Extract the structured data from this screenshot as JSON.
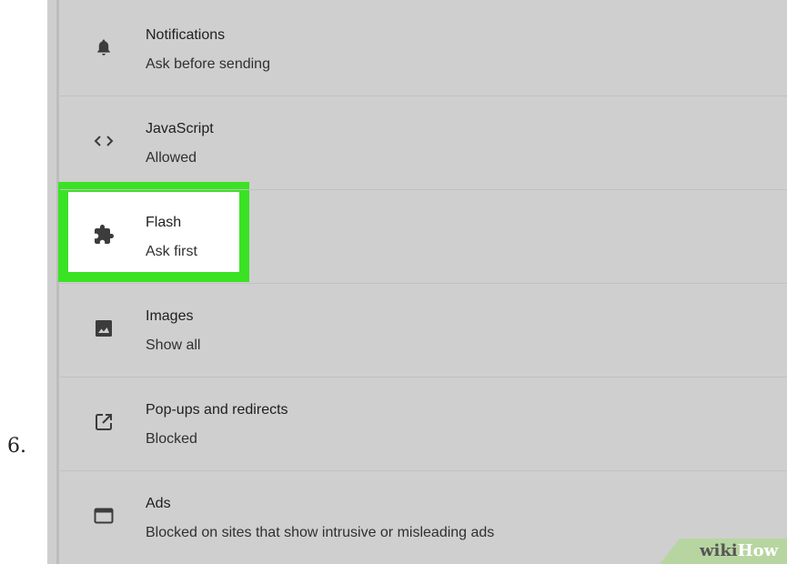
{
  "step": "6.",
  "settings": [
    {
      "title": "Notifications",
      "subtitle": "Ask before sending",
      "icon": "bell-icon"
    },
    {
      "title": "JavaScript",
      "subtitle": "Allowed",
      "icon": "code-brackets-icon"
    },
    {
      "title": "Flash",
      "subtitle": "Ask first",
      "icon": "puzzle-piece-icon"
    },
    {
      "title": "Images",
      "subtitle": "Show all",
      "icon": "image-icon"
    },
    {
      "title": "Pop-ups and redirects",
      "subtitle": "Blocked",
      "icon": "open-in-new-icon"
    },
    {
      "title": "Ads",
      "subtitle": "Blocked on sites that show intrusive or misleading ads",
      "icon": "browser-window-icon"
    }
  ],
  "highlight": {
    "target": "Flash",
    "color": "#3ae224"
  },
  "watermark": {
    "part1": "wiki",
    "part2": "How"
  }
}
